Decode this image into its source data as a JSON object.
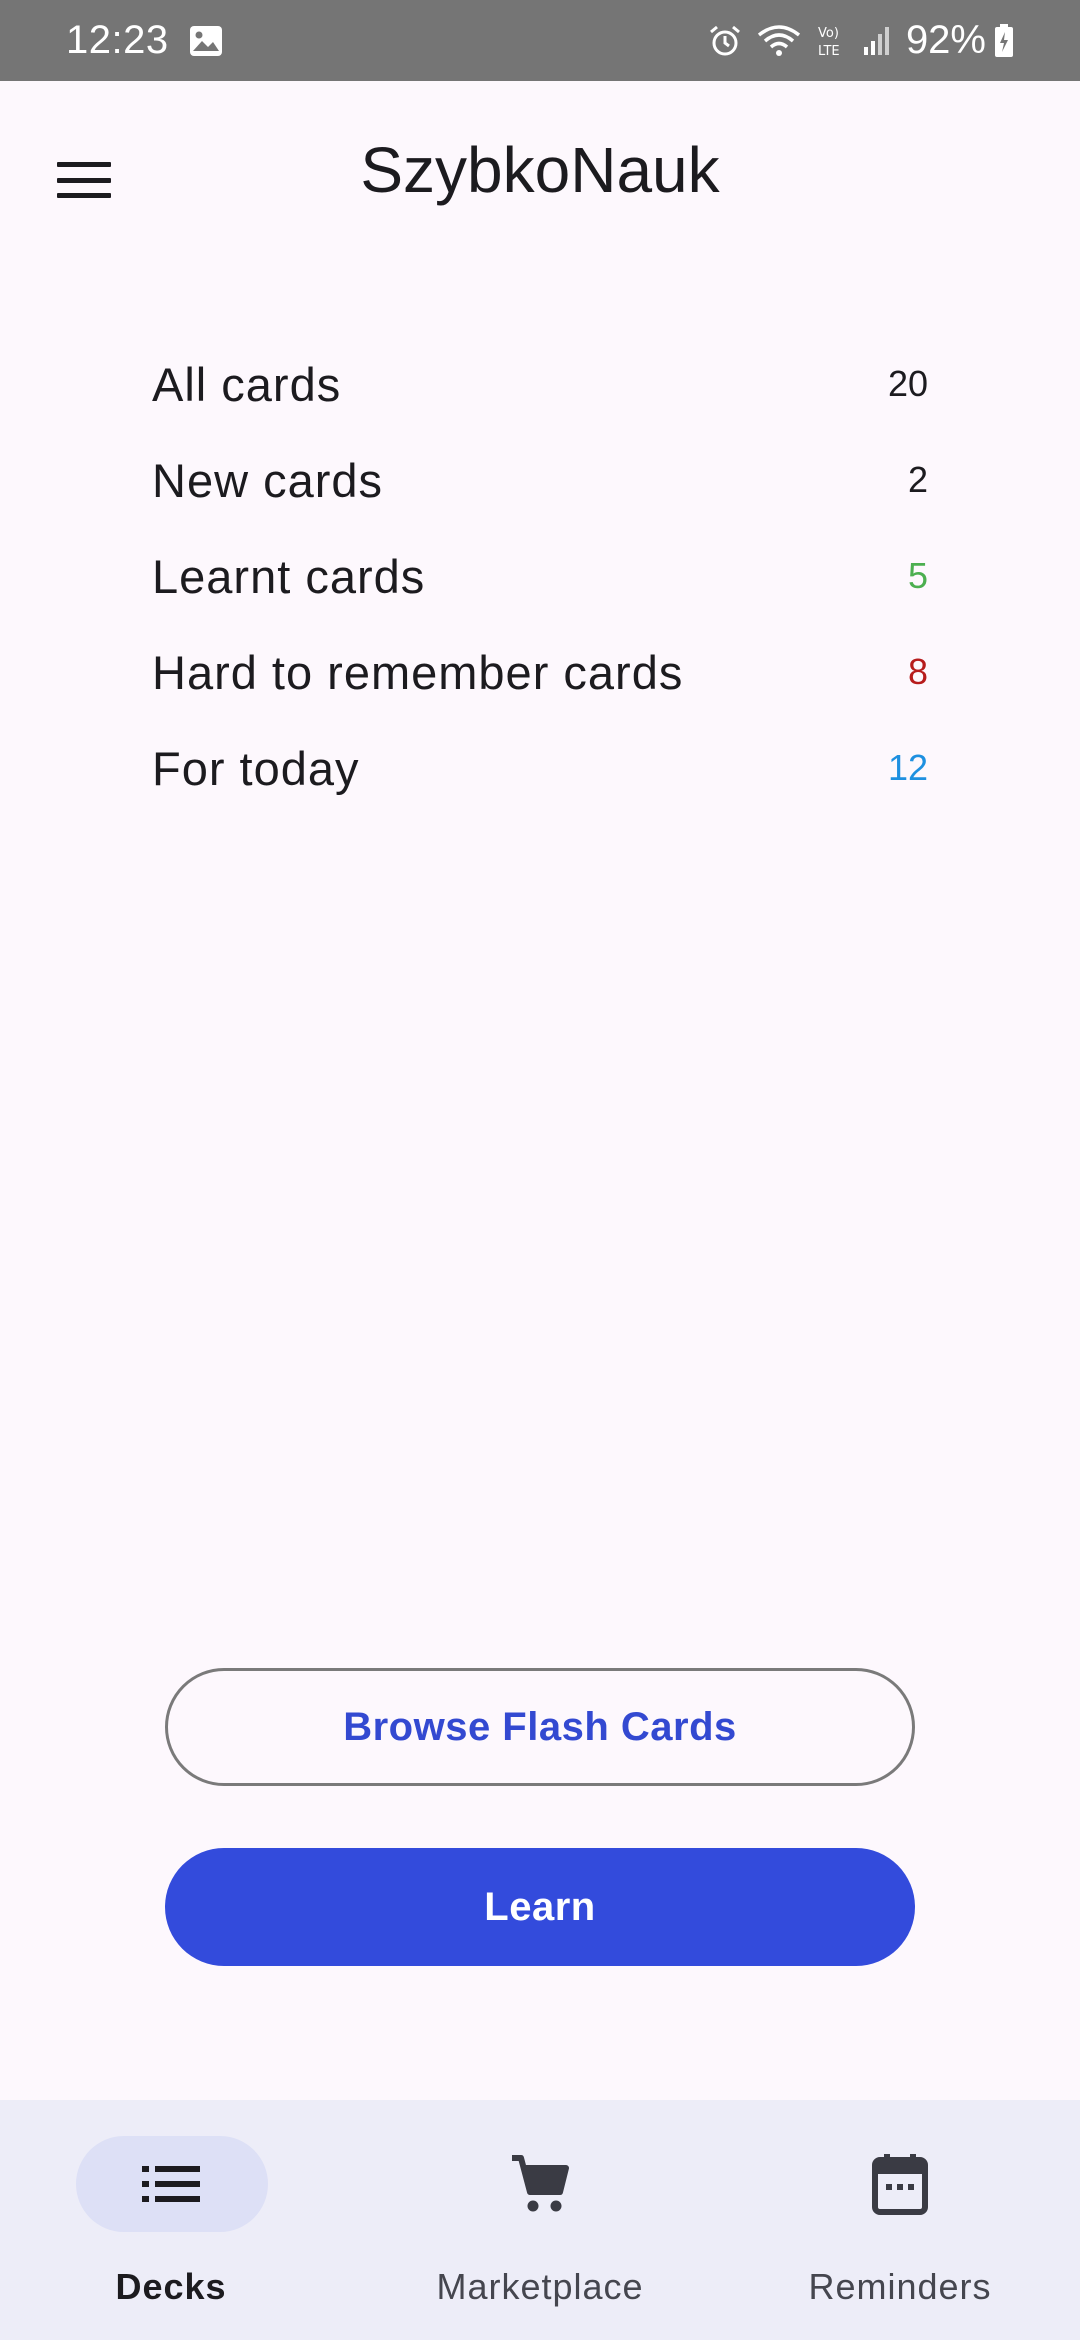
{
  "status_bar": {
    "time": "12:23",
    "battery": "92%",
    "icons": [
      "gallery-icon",
      "alarm-icon",
      "wifi-icon",
      "volte-icon",
      "signal-icon",
      "battery-charging-icon"
    ]
  },
  "app_bar": {
    "title": "SzybkoNauk",
    "menu_icon": "menu-icon"
  },
  "stats": [
    {
      "label": "All cards",
      "value": "20",
      "color": "#1c1b1f"
    },
    {
      "label": "New cards",
      "value": "2",
      "color": "#1c1b1f"
    },
    {
      "label": "Learnt cards",
      "value": "5",
      "color": "#4caf50"
    },
    {
      "label": "Hard to remember cards",
      "value": "8",
      "color": "#b71c1c"
    },
    {
      "label": "For today",
      "value": "12",
      "color": "#1e90e0"
    }
  ],
  "actions": {
    "browse_label": "Browse Flash Cards",
    "learn_label": "Learn"
  },
  "colors": {
    "accent": "#334bdc",
    "nav_background": "#ededf8",
    "nav_active_pill": "#dde0f6"
  },
  "bottom_nav": {
    "items": [
      {
        "label": "Decks",
        "icon": "list-icon",
        "active": true
      },
      {
        "label": "Marketplace",
        "icon": "cart-icon",
        "active": false
      },
      {
        "label": "Reminders",
        "icon": "calendar-icon",
        "active": false
      }
    ]
  }
}
